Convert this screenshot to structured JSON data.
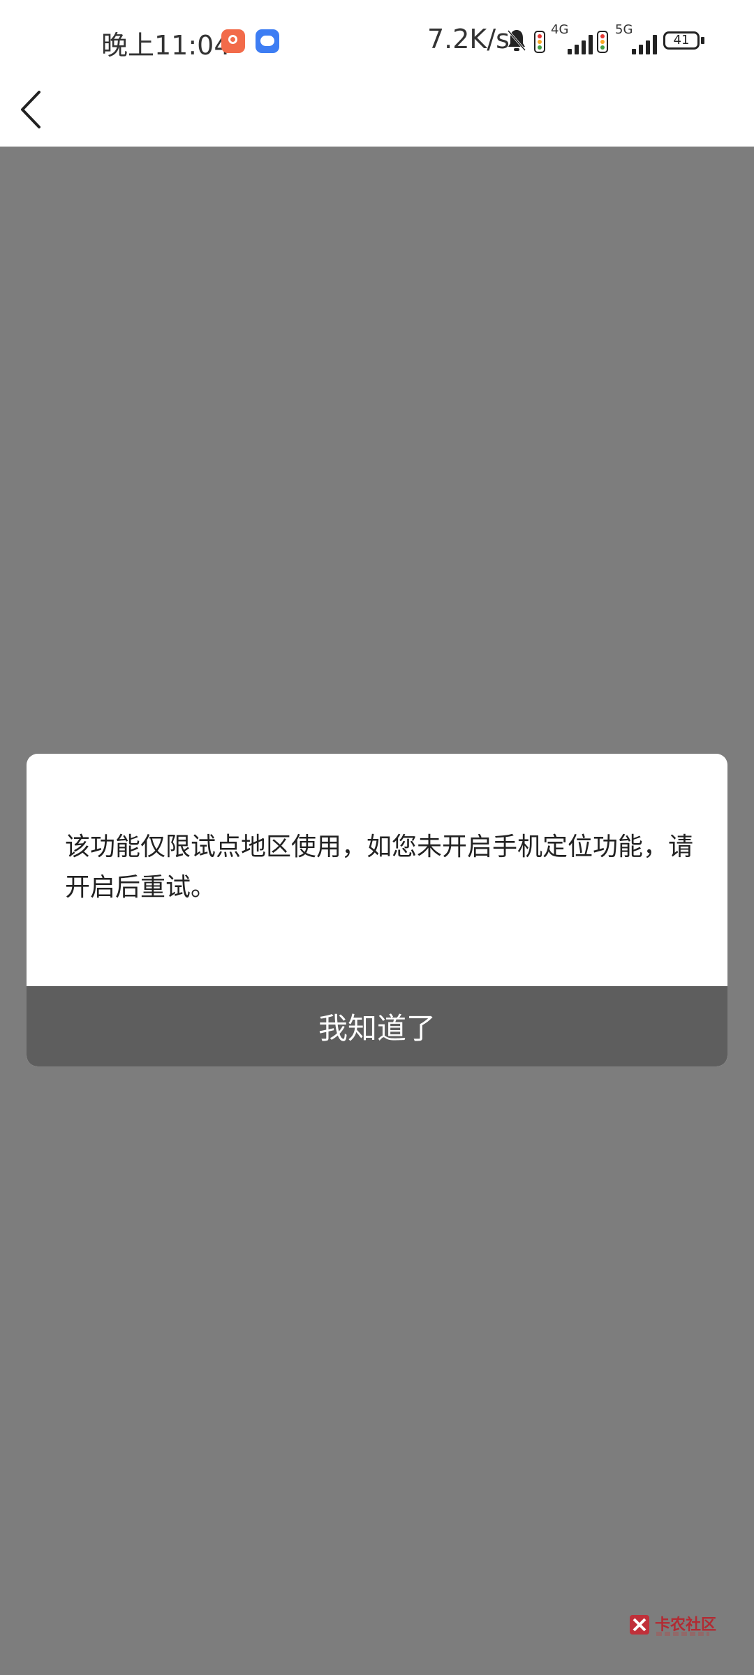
{
  "status_bar": {
    "time": "晚上11:04",
    "net_speed": "7.2K/s",
    "sim1_tag": "4G",
    "sim2_tag": "5G",
    "battery": "41"
  },
  "dialog": {
    "message": "该功能仅限试点地区使用，如您未开启手机定位功能，请开启后重试。",
    "button_label": "我知道了"
  },
  "watermark": {
    "text": "卡农社区"
  },
  "icons": [
    "back-arrow",
    "app-notification-icon",
    "message-icon",
    "mute-bell-icon",
    "signal-icon",
    "battery-icon"
  ],
  "colors": {
    "overlay": "#7d7d7d",
    "dialog_button": "#5e5e5e",
    "dialog_bg": "#ffffff"
  }
}
